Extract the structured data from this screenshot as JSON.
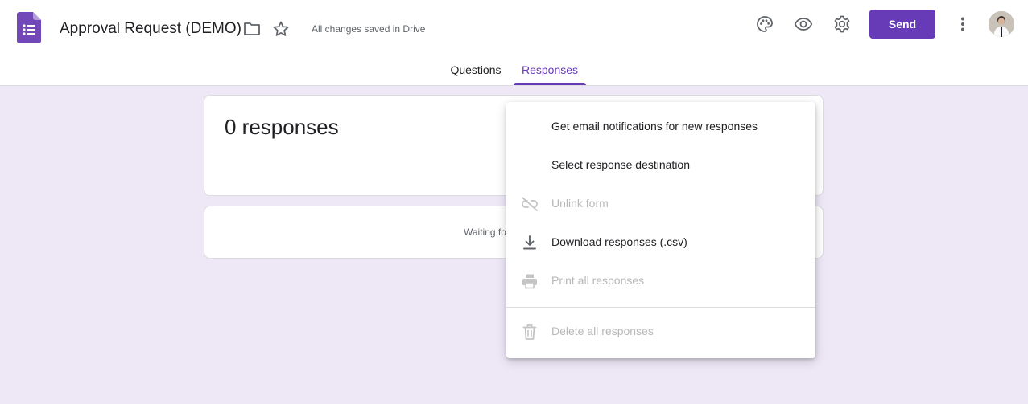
{
  "header": {
    "app_icon": "forms-app-icon",
    "title": "Approval Request (DEMO)",
    "save_status": "All changes saved in Drive",
    "send_label": "Send",
    "icons": [
      "folder-icon",
      "star-icon",
      "palette-icon",
      "eye-icon",
      "gear-icon",
      "more-vert-icon",
      "avatar"
    ]
  },
  "tabs": [
    {
      "label": "Questions",
      "active": false
    },
    {
      "label": "Responses",
      "active": true
    }
  ],
  "summary": {
    "count_text": "0 responses"
  },
  "waiting": {
    "text": "Waiting fo"
  },
  "menu": {
    "items": [
      {
        "label": "Get email notifications for new responses",
        "icon": "",
        "disabled": false
      },
      {
        "label": "Select response destination",
        "icon": "",
        "disabled": false
      },
      {
        "label": "Unlink form",
        "icon": "unlink-icon",
        "disabled": true
      },
      {
        "label": "Download responses (.csv)",
        "icon": "download-icon",
        "disabled": false
      },
      {
        "label": "Print all responses",
        "icon": "print-icon",
        "disabled": true
      },
      {
        "label": "Delete all responses",
        "icon": "trash-icon",
        "disabled": true
      }
    ]
  },
  "colors": {
    "accent": "#673ab7",
    "background": "#ede7f6",
    "disabled_text": "#b8b8b8"
  }
}
